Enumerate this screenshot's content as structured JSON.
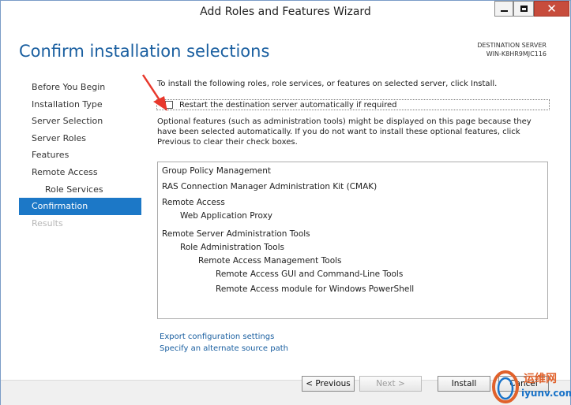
{
  "window": {
    "title": "Add Roles and Features Wizard",
    "close_glyph": "✕"
  },
  "header": {
    "heading": "Confirm installation selections",
    "destination_label": "DESTINATION SERVER",
    "destination_server": "WIN-K8HR9MJC116"
  },
  "nav": {
    "items": [
      {
        "label": "Before You Begin",
        "state": "normal"
      },
      {
        "label": "Installation Type",
        "state": "normal"
      },
      {
        "label": "Server Selection",
        "state": "normal"
      },
      {
        "label": "Server Roles",
        "state": "normal"
      },
      {
        "label": "Features",
        "state": "normal"
      },
      {
        "label": "Remote Access",
        "state": "normal"
      },
      {
        "label": "Role Services",
        "state": "sub"
      },
      {
        "label": "Confirmation",
        "state": "active"
      },
      {
        "label": "Results",
        "state": "disabled"
      }
    ]
  },
  "main": {
    "intro": "To install the following roles, role services, or features on selected server, click Install.",
    "restart_label": "Restart the destination server automatically if required",
    "restart_checked": false,
    "optional_note": "Optional features (such as administration tools) might be displayed on this page because they have been selected automatically. If you do not want to install these optional features, click Previous to clear their check boxes.",
    "features": [
      {
        "label": "Group Policy Management",
        "level": 0
      },
      {
        "label": "RAS Connection Manager Administration Kit (CMAK)",
        "level": 0
      },
      {
        "label": "Remote Access",
        "level": 0
      },
      {
        "label": "Web Application Proxy",
        "level": 1
      },
      {
        "label": "Remote Server Administration Tools",
        "level": 0
      },
      {
        "label": "Role Administration Tools",
        "level": 1
      },
      {
        "label": "Remote Access Management Tools",
        "level": 2
      },
      {
        "label": "Remote Access GUI and Command-Line Tools",
        "level": 3
      },
      {
        "label": "Remote Access module for Windows PowerShell",
        "level": 3
      }
    ],
    "export_link": "Export configuration settings",
    "alternate_link": "Specify an alternate source path"
  },
  "footer": {
    "previous": "< Previous",
    "next": "Next >",
    "install": "Install",
    "cancel": "Cancel"
  },
  "colors": {
    "accent": "#1c78c7",
    "heading": "#1a5fa0",
    "close_button": "#c74c3c",
    "annotation_arrow": "#e8382c"
  },
  "watermark": {
    "site_cn": "运维网",
    "site_en": "iyunv.com"
  }
}
